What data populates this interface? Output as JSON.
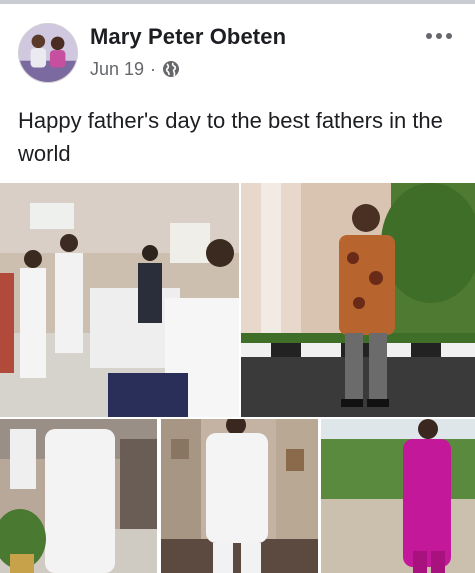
{
  "post": {
    "author": "Mary Peter Obeten",
    "date": "Jun 19",
    "separator": "·",
    "privacy_icon": "globe-icon",
    "more_icon": "more-options-icon",
    "text": "Happy father's day to the best fathers in the world"
  },
  "photos": [
    {
      "id": "photo-1"
    },
    {
      "id": "photo-2"
    },
    {
      "id": "photo-3"
    },
    {
      "id": "photo-4"
    },
    {
      "id": "photo-5"
    }
  ],
  "colors": {
    "text_primary": "#1c1e21",
    "text_secondary": "#65676b",
    "divider": "#c9ccd1"
  }
}
